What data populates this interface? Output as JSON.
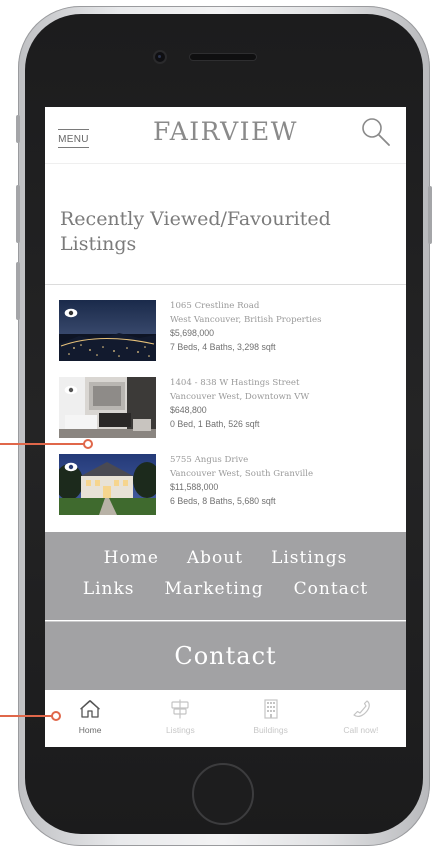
{
  "app": {
    "brand": "FAIRVIEW",
    "menu_label": "MENU"
  },
  "section_title": "Recently Viewed/Favourited Listings",
  "listings": [
    {
      "address": "1065 Crestline Road",
      "area": "West Vancouver, British Properties",
      "price": "$5,698,000",
      "specs": "7 Beds, 4 Baths, 3,298 sqft"
    },
    {
      "address": "1404 - 838 W Hastings Street",
      "area": "Vancouver West, Downtown VW",
      "price": "$648,800",
      "specs": "0 Bed, 1 Bath, 526 sqft"
    },
    {
      "address": "5755 Angus Drive",
      "area": "Vancouver West, South Granville",
      "price": "$11,588,000",
      "specs": "6 Beds, 8 Baths, 5,680 sqft"
    }
  ],
  "footer_nav": {
    "row1": [
      "Home",
      "About",
      "Listings"
    ],
    "row2": [
      "Links",
      "Marketing",
      "Contact"
    ]
  },
  "contact_label": "Contact",
  "tabbar": [
    {
      "label": "Home",
      "icon": "house-icon",
      "active": true
    },
    {
      "label": "Listings",
      "icon": "signpost-icon",
      "active": false
    },
    {
      "label": "Buildings",
      "icon": "building-icon",
      "active": false
    },
    {
      "label": "Call now!",
      "icon": "phone-icon",
      "active": false
    }
  ],
  "colors": {
    "footer_bg": "#a2a2a4",
    "callout": "#e0674a",
    "brand_text": "#8a8a8a"
  }
}
